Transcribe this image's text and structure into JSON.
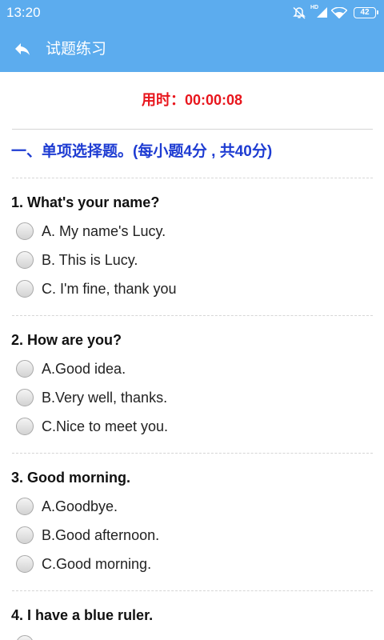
{
  "status_bar": {
    "time": "13:20",
    "hd_label": "HD",
    "battery_level": "42",
    "icons": [
      "mute-icon",
      "signal-icon",
      "wifi-icon",
      "battery-icon"
    ]
  },
  "app_bar": {
    "title": "试题练习",
    "back_icon": "back-arrow-icon"
  },
  "timer": {
    "label": "用时：",
    "value": "00:00:08"
  },
  "section": {
    "heading": "一、单项选择题。(每小题4分 , 共40分)"
  },
  "questions": [
    {
      "title": "1. What's your name?",
      "options": [
        "A. My name's Lucy.",
        "B. This is Lucy.",
        "C. I'm fine, thank you"
      ]
    },
    {
      "title": "2. How are you?",
      "options": [
        "A.Good idea.",
        "B.Very well, thanks.",
        "C.Nice to meet you."
      ]
    },
    {
      "title": "3. Good morning.",
      "options": [
        "A.Goodbye.",
        "B.Good afternoon.",
        "C.Good morning."
      ]
    },
    {
      "title": "4. I have a blue ruler.",
      "options": []
    }
  ],
  "colors": {
    "app_bar": "#5CACEE",
    "timer": "#E8161D",
    "section_heading": "#1E3CD2",
    "question_text": "#111111",
    "option_text": "#222222",
    "separator": "#D6D6D6"
  }
}
